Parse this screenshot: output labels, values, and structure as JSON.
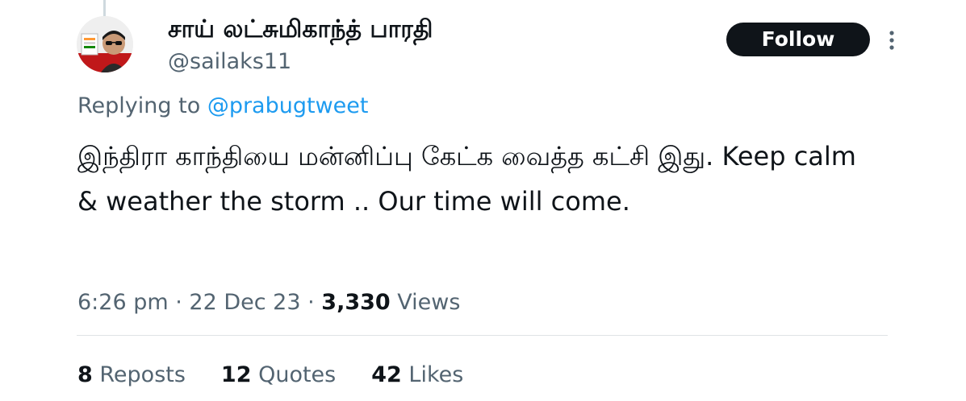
{
  "author": {
    "display_name": "சாய் லட்சுமிகாந்த் பாரதி",
    "handle": "@sailaks11",
    "avatar_icon": "profile-avatar"
  },
  "follow_button": {
    "label": "Follow"
  },
  "more_icon": "more-vertical-icon",
  "reply": {
    "prefix": "Replying to ",
    "mention": "@prabugtweet"
  },
  "tweet": {
    "text": "இந்திரா காந்தியை மன்னிப்பு கேட்க வைத்த கட்சி இது. Keep calm & weather the storm .. Our time will come."
  },
  "meta": {
    "time": "6:26 pm",
    "separator": " · ",
    "date": "22 Dec 23",
    "views_count": "3,330",
    "views_label": " Views"
  },
  "stats": {
    "reposts": {
      "count": "8",
      "label": " Reposts"
    },
    "quotes": {
      "count": "12",
      "label": " Quotes"
    },
    "likes": {
      "count": "42",
      "label": " Likes"
    }
  },
  "colors": {
    "text": "#0f1419",
    "secondary": "#536471",
    "link": "#1d9bf0",
    "button_bg": "#0f1419",
    "divider": "#dfe3e6"
  }
}
